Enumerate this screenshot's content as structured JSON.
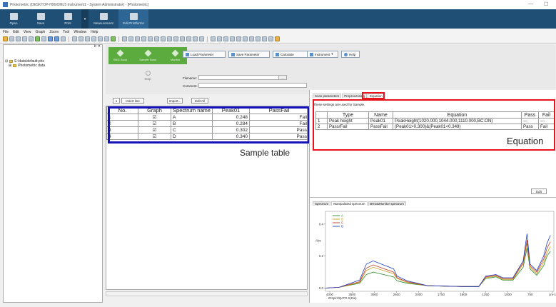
{
  "window": {
    "title": "Photometric (DESKTOP-H9GOML5 Instrument1 - System Administrator) - [Photometric]",
    "minimize": "—",
    "restore": "☐"
  },
  "ribbon": {
    "buttons": [
      {
        "label": "Open",
        "icon": "folder-icon"
      },
      {
        "label": "Save",
        "icon": "save-icon"
      },
      {
        "label": "Print",
        "icon": "print-icon"
      },
      {
        "label": "Measurement",
        "icon": "measurement-icon"
      },
      {
        "label": "Edit Printforms",
        "icon": "printform-icon"
      }
    ],
    "dropdown": "▾"
  },
  "menubar": {
    "items": [
      "File",
      "Edit",
      "View",
      "Graph",
      "Zoom",
      "Tool",
      "Window",
      "Help"
    ]
  },
  "tree": {
    "root": "E:\\data\\default.phs",
    "child": "Photometric data",
    "pin": "ᐅ ✕"
  },
  "measure": {
    "scan_buttons": [
      "BKG Scan",
      "Sample Scan",
      "Monitor"
    ],
    "stop_label": "Stop",
    "load_parameter": "Load Parameter",
    "save_parameter": "Save Parameter",
    "calculate": "Calculate",
    "instrument": "Instrument",
    "help": "Help",
    "filename_label": "Filename:",
    "comment_label": "Comment:",
    "browse": "..."
  },
  "sample_toolbar": {
    "row_number": "1",
    "insert_line": "Insert line",
    "import": "Import...",
    "edit_all": "Edit All"
  },
  "sample_table": {
    "headers": [
      "No.",
      "Graph",
      "Spectrum name",
      "Peak01",
      "PassFail"
    ],
    "rows": [
      {
        "no": "1",
        "graph": "☑",
        "name": "A",
        "peak": "0.248",
        "pf": "Fail"
      },
      {
        "no": "2",
        "graph": "☑",
        "name": "B",
        "peak": "0.284",
        "pf": "Fail"
      },
      {
        "no": "3",
        "graph": "☑",
        "name": "C",
        "peak": "0.302",
        "pf": "Pass"
      },
      {
        "no": "4",
        "graph": "☑",
        "name": "D",
        "peak": "0.340",
        "pf": "Pass"
      }
    ],
    "callout": "Sample table"
  },
  "right_tabs": {
    "tabs": [
      "Scan parameters",
      "Preprocessing",
      "Equation"
    ],
    "note": "These settings are used for Sample."
  },
  "equation_table": {
    "headers": [
      "Type",
      "Name",
      "Equation",
      "Pass",
      "Fail"
    ],
    "rows": [
      {
        "no": "1",
        "type": "Peak height",
        "name": "Peak01",
        "eq": "PeakHeight(1020.000,1044.000,1110.000,BC:ON)",
        "pass": "---",
        "fail": "---"
      },
      {
        "no": "2",
        "type": "Pass/Fail",
        "name": "PassFail",
        "eq": "(Peak01>0.300)&(Peak01<0.349)",
        "pass": "Pass",
        "fail": "Fail"
      }
    ],
    "callout": "Equation",
    "edit": "Edit"
  },
  "spectrum_tabs": [
    "Spectrum",
    "Manipulated spectrum",
    "BKG&Monitor spectrum"
  ],
  "chart_data": {
    "type": "line",
    "title": "",
    "xlabel": "IRSpirit/QATR-S(Dia)",
    "ylabel": "Abs",
    "xlim": [
      4000,
      650
    ],
    "ylim": [
      -0.02,
      0.48
    ],
    "x_ticks": [
      "4000",
      "3500",
      "3000",
      "2500",
      "2000",
      "1750",
      "1500",
      "1250",
      "1000",
      "750",
      "cm-1"
    ],
    "y_ticks": [
      "0.4",
      "0.2",
      "0.0"
    ],
    "legend_placement": "top-left",
    "series": [
      {
        "name": "A",
        "color": "#2e8b2e",
        "x": [
          4000,
          3800,
          3500,
          3400,
          3300,
          3000,
          2950,
          2800,
          2500,
          2000,
          1750,
          1650,
          1500,
          1400,
          1250,
          1100,
          1044,
          1000,
          900,
          800,
          750,
          700
        ],
        "y": [
          0.0,
          0.005,
          0.03,
          0.085,
          0.1,
          0.07,
          0.045,
          0.03,
          0.015,
          0.01,
          0.01,
          0.06,
          0.07,
          0.05,
          0.05,
          0.13,
          0.25,
          0.12,
          0.08,
          0.14,
          0.2,
          0.23
        ]
      },
      {
        "name": "B",
        "color": "#c8a020",
        "x": [
          4000,
          3800,
          3500,
          3400,
          3300,
          3000,
          2950,
          2800,
          2500,
          2000,
          1750,
          1650,
          1500,
          1400,
          1250,
          1100,
          1044,
          1000,
          900,
          800,
          750,
          700
        ],
        "y": [
          0.0,
          0.005,
          0.035,
          0.11,
          0.13,
          0.09,
          0.06,
          0.035,
          0.015,
          0.01,
          0.01,
          0.065,
          0.075,
          0.055,
          0.055,
          0.15,
          0.28,
          0.13,
          0.09,
          0.16,
          0.22,
          0.26
        ]
      },
      {
        "name": "C",
        "color": "#c0392b",
        "x": [
          4000,
          3800,
          3500,
          3400,
          3300,
          3000,
          2950,
          2800,
          2500,
          2000,
          1750,
          1650,
          1500,
          1400,
          1250,
          1100,
          1044,
          1000,
          900,
          800,
          750,
          700
        ],
        "y": [
          0.0,
          0.005,
          0.04,
          0.125,
          0.145,
          0.1,
          0.065,
          0.04,
          0.015,
          0.01,
          0.01,
          0.07,
          0.08,
          0.06,
          0.06,
          0.16,
          0.3,
          0.14,
          0.1,
          0.18,
          0.25,
          0.29
        ]
      },
      {
        "name": "D",
        "color": "#1f3fbf",
        "x": [
          4000,
          3800,
          3500,
          3400,
          3300,
          3000,
          2950,
          2800,
          2500,
          2000,
          1750,
          1650,
          1500,
          1400,
          1250,
          1100,
          1044,
          1000,
          900,
          800,
          750,
          700
        ],
        "y": [
          0.0,
          0.005,
          0.05,
          0.15,
          0.17,
          0.12,
          0.075,
          0.045,
          0.015,
          0.01,
          0.01,
          0.075,
          0.085,
          0.065,
          0.065,
          0.17,
          0.34,
          0.15,
          0.11,
          0.2,
          0.28,
          0.33
        ]
      }
    ]
  }
}
